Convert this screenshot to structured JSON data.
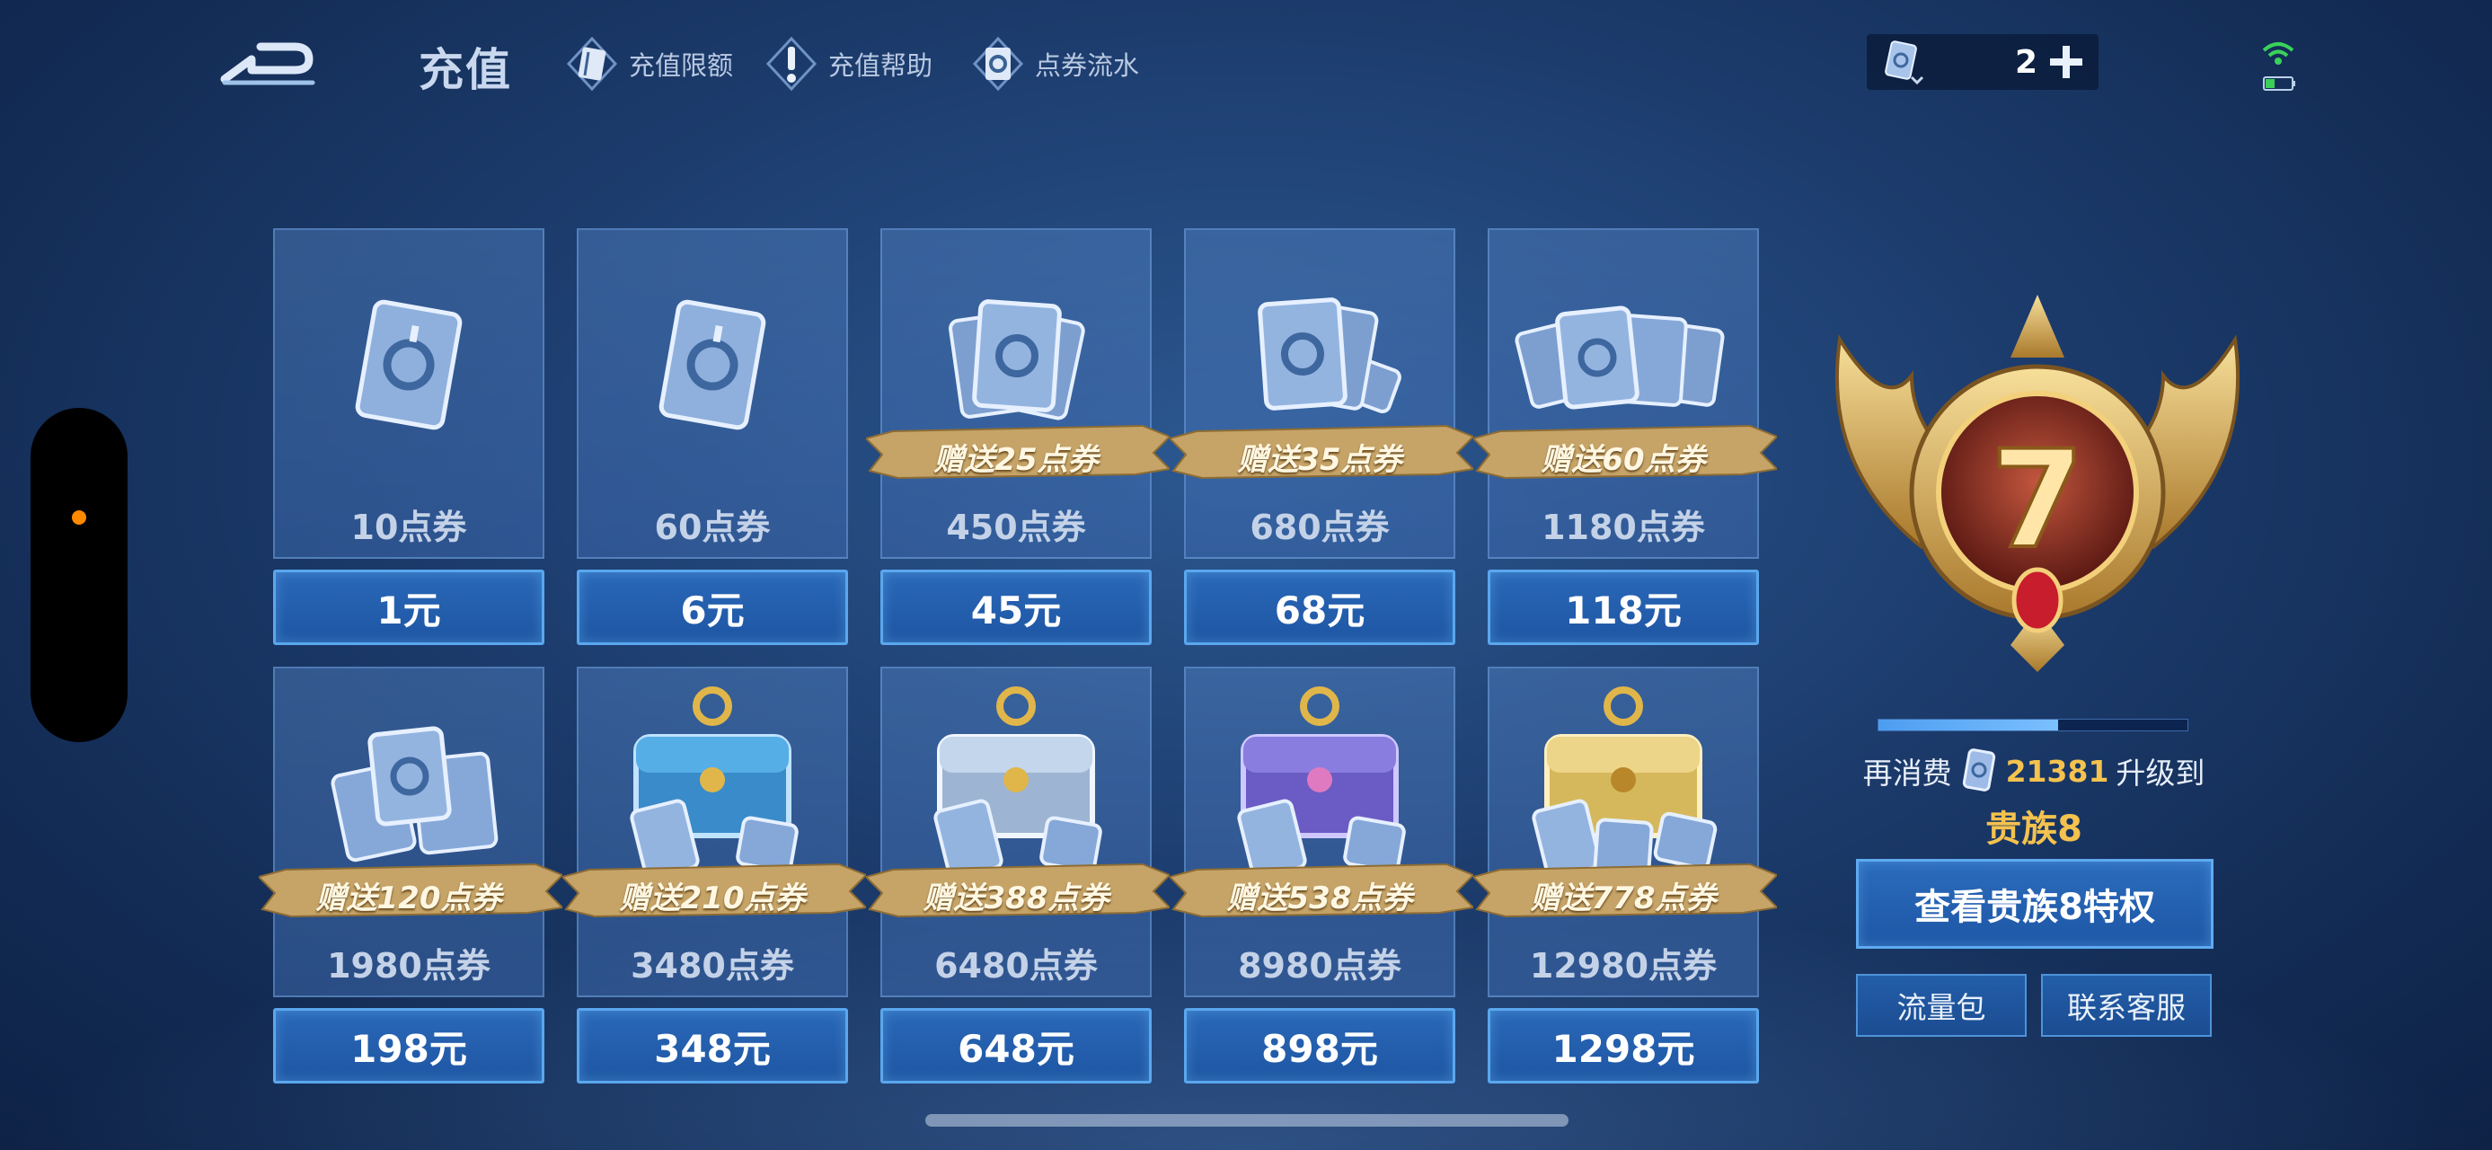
{
  "header": {
    "title": "充值",
    "nav": [
      {
        "label": "充值限额",
        "icon": "card-icon"
      },
      {
        "label": "充值帮助",
        "icon": "exclamation-icon"
      },
      {
        "label": "点券流水",
        "icon": "coupon-icon"
      }
    ],
    "balance": {
      "value": "2",
      "icon": "coupon-icon",
      "add_icon": "plus-icon"
    }
  },
  "packs": [
    {
      "amount": "10点券",
      "price": "1元",
      "bonus": ""
    },
    {
      "amount": "60点券",
      "price": "6元",
      "bonus": ""
    },
    {
      "amount": "450点券",
      "price": "45元",
      "bonus": "赠送25点券"
    },
    {
      "amount": "680点券",
      "price": "68元",
      "bonus": "赠送35点券"
    },
    {
      "amount": "1180点券",
      "price": "118元",
      "bonus": "赠送60点券"
    },
    {
      "amount": "1980点券",
      "price": "198元",
      "bonus": "赠送120点券"
    },
    {
      "amount": "3480点券",
      "price": "348元",
      "bonus": "赠送210点券"
    },
    {
      "amount": "6480点券",
      "price": "648元",
      "bonus": "赠送388点券"
    },
    {
      "amount": "8980点券",
      "price": "898元",
      "bonus": "赠送538点券"
    },
    {
      "amount": "12980点券",
      "price": "1298元",
      "bonus": "赠送778点券"
    }
  ],
  "noble": {
    "current_level": "7",
    "progress_fraction": 0.58,
    "upgrade_prefix": "再消费",
    "upgrade_amount": "21381",
    "upgrade_suffix": "升级到",
    "next_level": "贵族8",
    "privilege_button": "查看贵族8特权",
    "traffic_button": "流量包",
    "service_button": "联系客服"
  },
  "colors": {
    "accent_gold": "#f4c24e",
    "button_blue": "#1e56a3",
    "button_border": "#5aa7ee"
  }
}
